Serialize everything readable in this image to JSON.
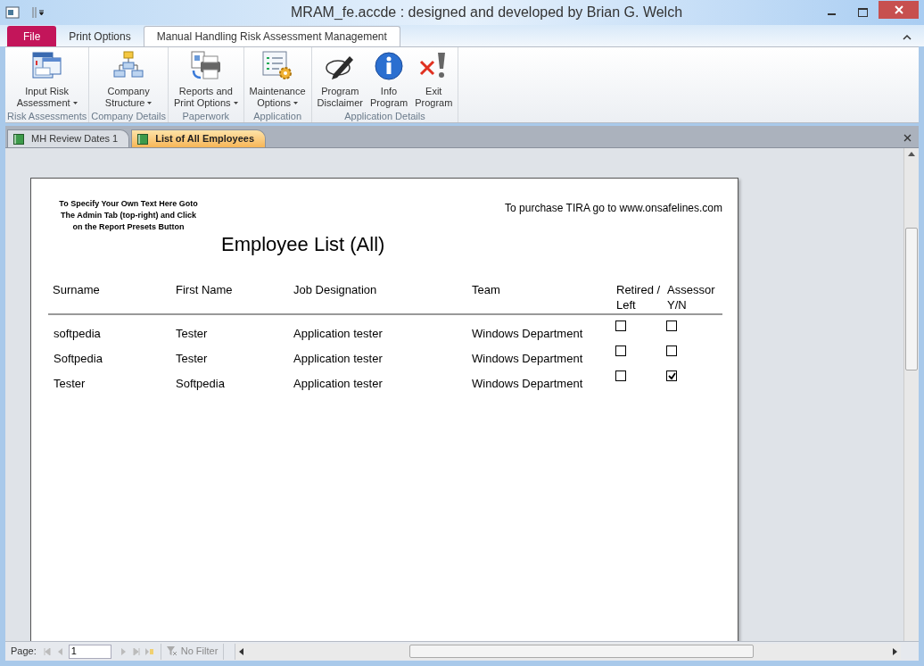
{
  "window": {
    "title": "MRAM_fe.accde : designed and developed by Brian G. Welch"
  },
  "ribbon_tabs": [
    {
      "label": "File",
      "kind": "file",
      "selected": false
    },
    {
      "label": "Print Options",
      "kind": "tab",
      "selected": false
    },
    {
      "label": "Manual Handling Risk Assessment Management",
      "kind": "tab",
      "selected": true
    }
  ],
  "ribbon_groups": [
    {
      "label": "Risk Assessments",
      "buttons": [
        {
          "lines": [
            "Input Risk",
            "Assessment"
          ],
          "dropdown": true,
          "kind": "forms"
        }
      ]
    },
    {
      "label": "Company Details",
      "buttons": [
        {
          "lines": [
            "Company",
            "Structure"
          ],
          "dropdown": true,
          "kind": "orgchart"
        }
      ]
    },
    {
      "label": "Paperwork",
      "buttons": [
        {
          "lines": [
            "Reports and",
            "Print Options"
          ],
          "dropdown": true,
          "kind": "printer"
        }
      ]
    },
    {
      "label": "Application",
      "buttons": [
        {
          "lines": [
            "Maintenance",
            "Options"
          ],
          "dropdown": true,
          "kind": "checklist"
        }
      ]
    },
    {
      "label": "Application Details",
      "buttons": [
        {
          "lines": [
            "Program",
            "Disclaimer"
          ],
          "dropdown": false,
          "kind": "pen"
        },
        {
          "lines": [
            "Info",
            "Program"
          ],
          "dropdown": false,
          "kind": "info"
        },
        {
          "lines": [
            "Exit",
            "Program"
          ],
          "dropdown": false,
          "kind": "exit"
        }
      ]
    }
  ],
  "doc_tabs": [
    {
      "label": "MH Review Dates 1",
      "selected": false
    },
    {
      "label": "List of All Employees",
      "selected": true
    }
  ],
  "report": {
    "note_lines": [
      "To Specify Your Own Text Here Goto",
      "The Admin Tab (top-right) and Click",
      "on the Report Presets Button"
    ],
    "purchase_note": "To purchase TIRA go to www.onsafelines.com",
    "title": "Employee List (All)",
    "columns": [
      "Surname",
      "First Name",
      "Job Designation",
      "Team",
      "Retired / Left",
      "Assessor Y/N"
    ],
    "rows": [
      {
        "surname": "softpedia",
        "first_name": "Tester",
        "job": "Application tester",
        "team": "Windows Department",
        "retired": false,
        "assessor": false
      },
      {
        "surname": "Softpedia",
        "first_name": "Tester",
        "job": "Application tester",
        "team": "Windows Department",
        "retired": false,
        "assessor": false
      },
      {
        "surname": "Tester",
        "first_name": "Softpedia",
        "job": "Application tester",
        "team": "Windows Department",
        "retired": false,
        "assessor": true
      }
    ]
  },
  "nav": {
    "label": "Page:",
    "page": "1",
    "filter": "No Filter"
  }
}
